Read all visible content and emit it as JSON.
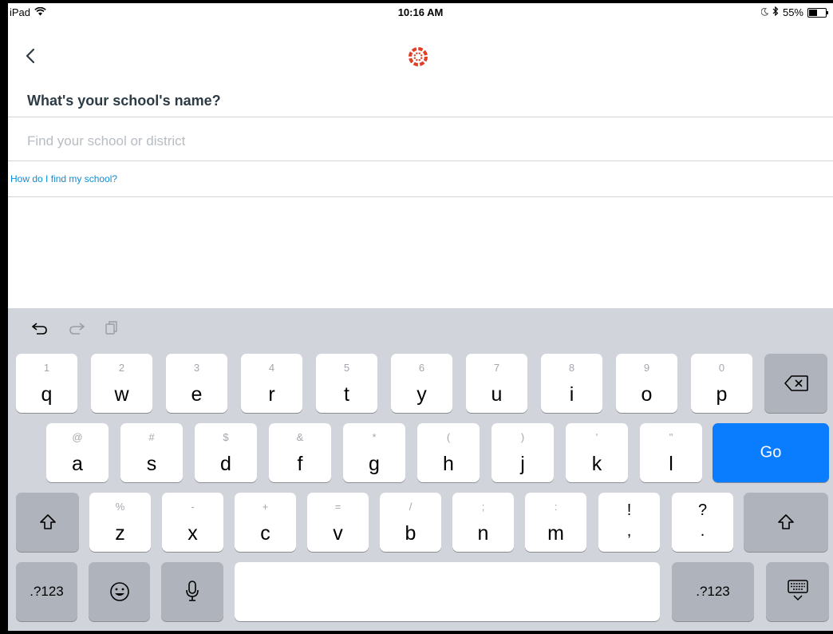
{
  "status_bar": {
    "device": "iPad",
    "time": "10:16 AM",
    "battery": "55%",
    "battery_level": 0.55,
    "icons": [
      "wifi-icon",
      "moon-icon",
      "bluetooth-icon",
      "battery-icon"
    ]
  },
  "nav": {
    "back_icon": "chevron-left-icon",
    "logo_icon": "canvas-logo-icon",
    "logo_color": "#e33f26"
  },
  "main": {
    "question": "What's your school's name?",
    "search_placeholder": "Find your school or district",
    "search_value": "",
    "help_link": "How do I find my school?",
    "link_color": "#0d8ed6"
  },
  "keyboard": {
    "toolbar": [
      "undo-icon",
      "redo-icon",
      "paste-icon"
    ],
    "row1": [
      {
        "top": "1",
        "main": "q"
      },
      {
        "top": "2",
        "main": "w"
      },
      {
        "top": "3",
        "main": "e"
      },
      {
        "top": "4",
        "main": "r"
      },
      {
        "top": "5",
        "main": "t"
      },
      {
        "top": "6",
        "main": "y"
      },
      {
        "top": "7",
        "main": "u"
      },
      {
        "top": "8",
        "main": "i"
      },
      {
        "top": "9",
        "main": "o"
      },
      {
        "top": "0",
        "main": "p"
      }
    ],
    "row2": [
      {
        "top": "@",
        "main": "a"
      },
      {
        "top": "#",
        "main": "s"
      },
      {
        "top": "$",
        "main": "d"
      },
      {
        "top": "&",
        "main": "f"
      },
      {
        "top": "*",
        "main": "g"
      },
      {
        "top": "(",
        "main": "h"
      },
      {
        "top": ")",
        "main": "j"
      },
      {
        "top": "'",
        "main": "k"
      },
      {
        "top": "\"",
        "main": "l"
      }
    ],
    "row3": [
      {
        "top": "%",
        "main": "z"
      },
      {
        "top": "-",
        "main": "x"
      },
      {
        "top": "+",
        "main": "c"
      },
      {
        "top": "=",
        "main": "v"
      },
      {
        "top": "/",
        "main": "b"
      },
      {
        "top": ";",
        "main": "n"
      },
      {
        "top": ":",
        "main": "m"
      }
    ],
    "punct": [
      {
        "top": "!",
        "main": ","
      },
      {
        "top": "?",
        "main": "."
      }
    ],
    "go_label": "Go",
    "numbers_label": ".?123",
    "go_color": "#0a7cfe"
  }
}
